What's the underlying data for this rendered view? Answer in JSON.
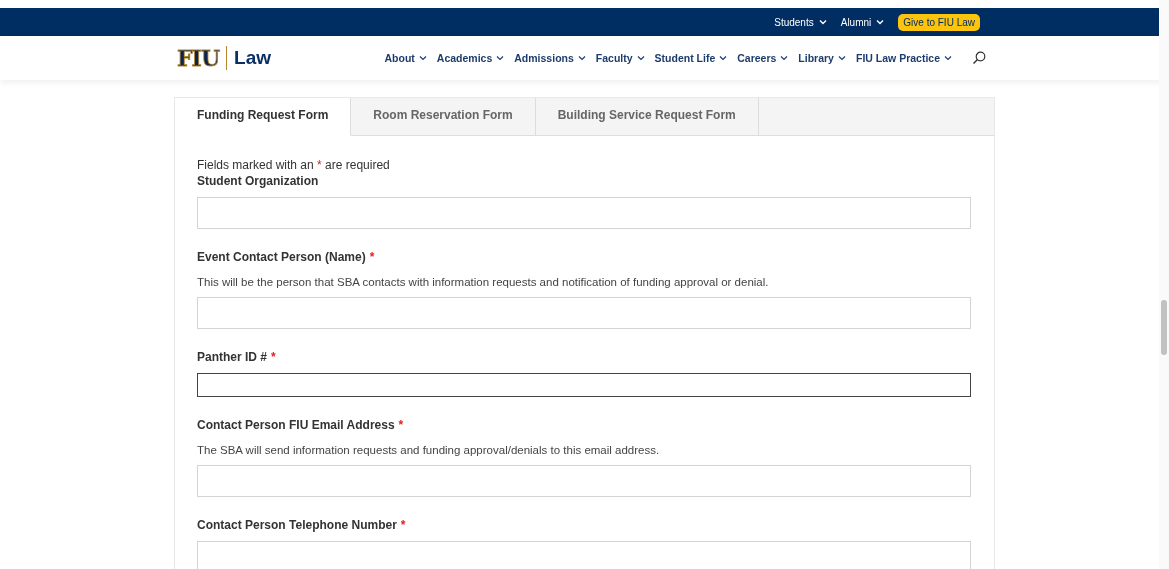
{
  "top_bar": {
    "links": [
      {
        "label": "Students"
      },
      {
        "label": "Alumni"
      }
    ],
    "button": "Give to FIU Law"
  },
  "header": {
    "logo": {
      "mark": "FIU",
      "text": "Law"
    },
    "nav": [
      {
        "label": "About"
      },
      {
        "label": "Academics"
      },
      {
        "label": "Admissions"
      },
      {
        "label": "Faculty"
      },
      {
        "label": "Student Life"
      },
      {
        "label": "Careers"
      },
      {
        "label": "Library"
      },
      {
        "label": "FIU Law Practice"
      }
    ]
  },
  "tabs": [
    {
      "label": "Funding Request Form",
      "selected": true
    },
    {
      "label": "Room Reservation Form",
      "selected": false
    },
    {
      "label": "Building Service Request Form",
      "selected": false
    }
  ],
  "intro": {
    "before": "Fields marked with an",
    "mark": "*",
    "after": "are required"
  },
  "fields": [
    {
      "label": "Student Organization",
      "focused": false
    },
    {
      "label": "Event Contact Person (Name)",
      "required_mark": "*",
      "help": "This will be the person that SBA contacts with information requests and notification of funding approval or denial.",
      "focused": false
    },
    {
      "label": "Panther ID #",
      "required_mark": "*",
      "focused": true
    },
    {
      "label": "Contact Person FIU Email Address",
      "required_mark": "*",
      "help": "The SBA will send information requests and funding approval/denials to this email address.",
      "focused": false
    },
    {
      "label": "Contact Person Telephone Number",
      "required_mark": "*",
      "focused": false
    }
  ]
}
